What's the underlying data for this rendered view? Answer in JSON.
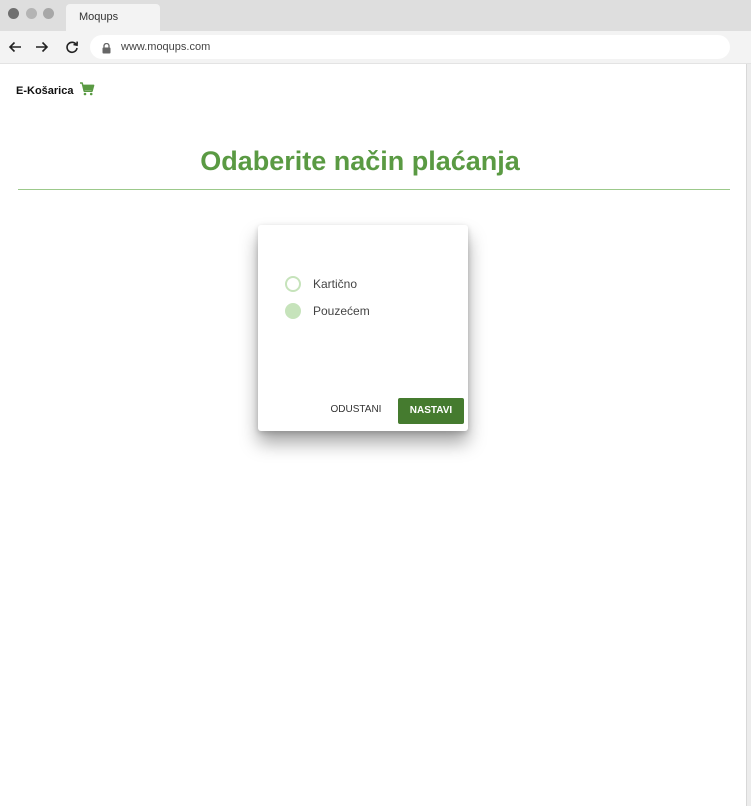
{
  "browser": {
    "tab_title": "Moqups",
    "url": "www.moqups.com"
  },
  "header": {
    "brand": "E-Košarica",
    "cart_icon": "shopping-cart-icon"
  },
  "page": {
    "title": "Odaberite način plaćanja"
  },
  "dialog": {
    "options": [
      {
        "label": "Kartično",
        "selected": false
      },
      {
        "label": "Pouzećem",
        "selected": true
      }
    ],
    "cancel_label": "ODUSTANI",
    "next_label": "NASTAVI"
  },
  "colors": {
    "accent": "#5a9a43",
    "button": "#457b2f",
    "radio": "#c6e3bb"
  }
}
